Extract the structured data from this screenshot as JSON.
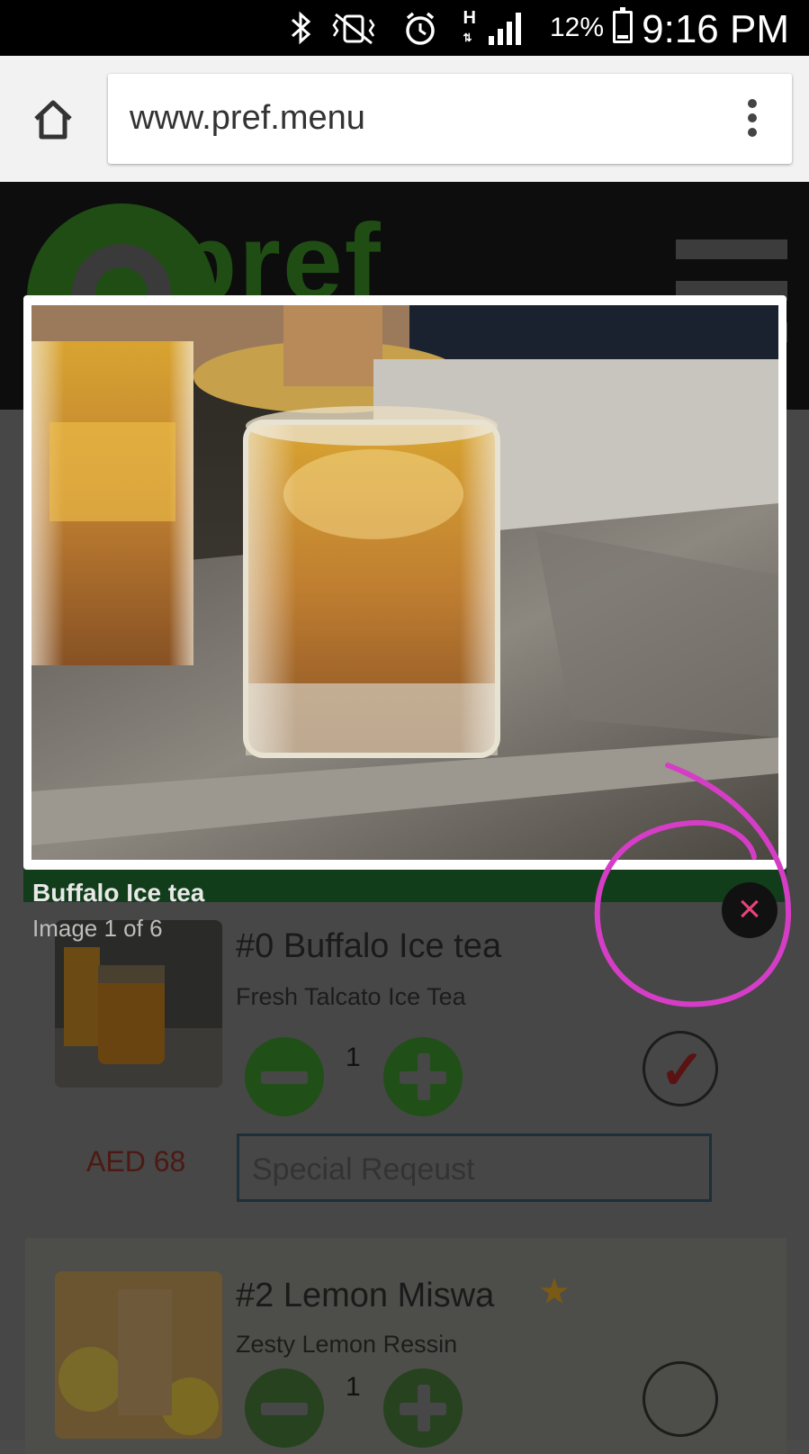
{
  "status_bar": {
    "battery": "12%",
    "time": "9:16 PM",
    "icons": [
      "bluetooth-icon",
      "vibrate-mute-icon",
      "alarm-icon",
      "hspa-icon",
      "signal-icon",
      "battery-icon"
    ]
  },
  "browser": {
    "url": "www.pref.menu",
    "home_icon": "home-icon",
    "menu_icon": "overflow-menu-icon"
  },
  "site": {
    "logo": "pref"
  },
  "lightbox": {
    "caption": "Buffalo Ice tea",
    "counter": "Image 1 of 6",
    "close_symbol": "×",
    "annotation_color": "#d63dc6"
  },
  "menu_items": [
    {
      "title": "#0 Buffalo Ice tea",
      "description": "Fresh Talcato Ice Tea",
      "quantity": "1",
      "selected": true,
      "check_symbol": "✓",
      "price": "AED 68",
      "request_placeholder": "Special Reqeust"
    },
    {
      "title": "#2 Lemon Miswa",
      "description": "Zesty Lemon Ressin",
      "quantity": "1",
      "selected": false,
      "star_symbol": "★"
    }
  ]
}
